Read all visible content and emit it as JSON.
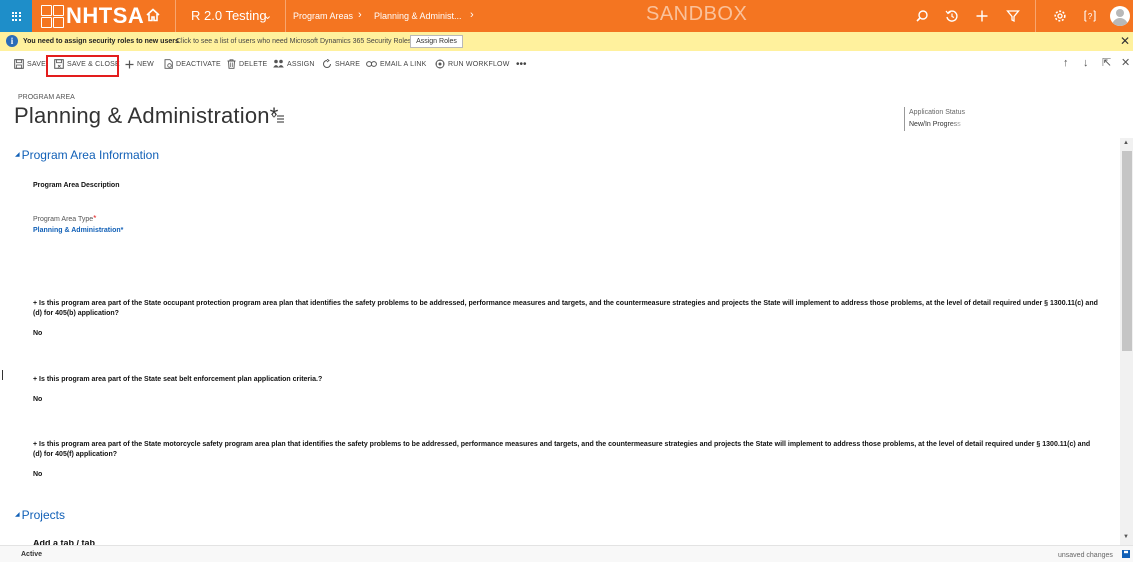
{
  "topnav": {
    "logo_text": "NHTSA",
    "environment": "R 2.0 Testing",
    "breadcrumb": [
      "Program Areas",
      "Planning & Administ..."
    ],
    "sandbox_label": "SANDBOX",
    "colors": {
      "bar": "#f47521",
      "waffle": "#1e8ec9"
    },
    "right_icons": [
      "search-icon",
      "history-icon",
      "plus-icon",
      "filter-icon",
      "settings-icon",
      "help-icon",
      "user-avatar"
    ]
  },
  "notification": {
    "message": "You need to assign security roles to new users",
    "detail": "Click to see a list of users who need Microsoft Dynamics 365 Security Roles.",
    "button": "Assign Roles",
    "color": "#fff19d"
  },
  "commands": [
    {
      "label": "SAVE",
      "icon": "save-icon"
    },
    {
      "label": "SAVE & CLOSE",
      "icon": "save-close-icon"
    },
    {
      "label": "NEW",
      "icon": "plus-icon"
    },
    {
      "label": "DEACTIVATE",
      "icon": "deactivate-icon"
    },
    {
      "label": "DELETE",
      "icon": "trash-icon"
    },
    {
      "label": "ASSIGN",
      "icon": "assign-icon"
    },
    {
      "label": "SHARE",
      "icon": "share-icon"
    },
    {
      "label": "EMAIL A LINK",
      "icon": "link-icon"
    },
    {
      "label": "RUN WORKFLOW",
      "icon": "workflow-icon"
    }
  ],
  "header": {
    "entity_type": "PROGRAM AREA",
    "title": "Planning & Administration*",
    "status_label": "Application Status",
    "status_value": "New/In Progress"
  },
  "section": {
    "title": "Program Area Information",
    "description_label": "Program Area Description",
    "type_label": "Program Area Type",
    "type_value": "Planning & Administration*",
    "questions": [
      {
        "text": "+ Is this program area part of the State occupant protection program area plan that identifies the safety problems to be addressed, performance measures and targets, and the countermeasure strategies and projects the State will implement to address those problems, at the level of detail required under § 1300.11(c) and (d) for 405(b) application?",
        "answer": "No"
      },
      {
        "text": "+ Is this program area part of the State seat belt enforcement plan application criteria.?",
        "answer": "No"
      },
      {
        "text": "+ Is this program area part of the State motorcycle safety program area plan that identifies the safety problems to be addressed, performance measures and targets, and the countermeasure strategies and projects the State will implement to address those problems, at the level of detail required under § 1300.11(c) and (d) for 405(f) application?",
        "answer": "No"
      }
    ]
  },
  "projects": {
    "title": "Projects",
    "cutoff_text": "Add a tab / tab"
  },
  "footer": {
    "status": "Active",
    "unsaved": "unsaved changes"
  },
  "accent": {
    "highlight": "#e31d1d",
    "link": "#1160b7"
  }
}
